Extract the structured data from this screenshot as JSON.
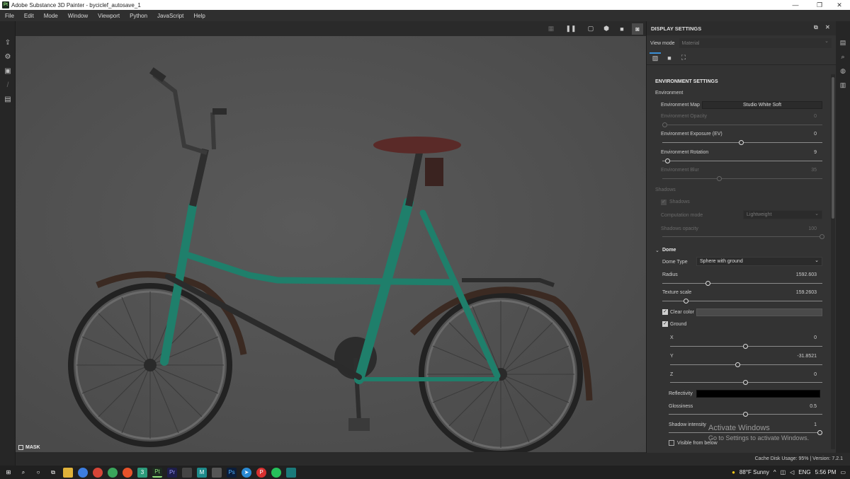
{
  "window": {
    "title": "Adobe Substance 3D Painter - byciclef_autosave_1",
    "app_icon_text": "Pt"
  },
  "menu": [
    "File",
    "Edit",
    "Mode",
    "Window",
    "Viewport",
    "Python",
    "JavaScript",
    "Help"
  ],
  "viewport": {
    "mask_label": "MASK",
    "accent_colors": {
      "frame": "#1f7f6b",
      "seat": "#5a2a28",
      "tire": "#2a2a2a"
    }
  },
  "panel": {
    "title": "DISPLAY SETTINGS",
    "view_mode_label": "View mode",
    "view_mode_value": "Material",
    "section_title": "ENVIRONMENT SETTINGS",
    "environment_group": "Environment",
    "environment_map_label": "Environment Map",
    "environment_map_value": "Studio White Soft",
    "env_opacity_label": "Environment Opacity",
    "env_opacity_value": "0",
    "env_exposure_label": "Environment Exposure (EV)",
    "env_exposure_value": "0",
    "env_rotation_label": "Environment Rotation",
    "env_rotation_value": "9",
    "env_blur_label": "Environment Blur",
    "env_blur_value": "35",
    "shadows_group": "Shadows",
    "shadows_checkbox_label": "Shadows",
    "computation_mode_label": "Computation mode",
    "computation_mode_value": "Lightweight",
    "shadows_opacity_label": "Shadows opacity",
    "shadows_opacity_value": "100",
    "dome_title": "Dome",
    "dome_type_label": "Dome Type",
    "dome_type_value": "Sphere with ground",
    "radius_label": "Radius",
    "radius_value": "1592.603",
    "texture_scale_label": "Texture scale",
    "texture_scale_value": "159.2603",
    "clear_color_label": "Clear color",
    "ground_label": "Ground",
    "x_label": "X",
    "x_value": "0",
    "y_label": "Y",
    "y_value": "-31.8521",
    "z_label": "Z",
    "z_value": "0",
    "reflectivity_label": "Reflectivity",
    "glossiness_label": "Glossiness",
    "glossiness_value": "0.5",
    "shadow_intensity_label": "Shadow intensity",
    "shadow_intensity_value": "1",
    "visible_from_below_label": "Visible from below"
  },
  "status": {
    "cache_text": "Cache Disk Usage:   95% | Version: 7.2.1"
  },
  "watermark": {
    "line1": "Activate Windows",
    "line2": "Go to Settings to activate Windows."
  },
  "taskbar": {
    "weather": "88°F  Sunny",
    "lang": "ENG",
    "time": "5:56 PM"
  }
}
